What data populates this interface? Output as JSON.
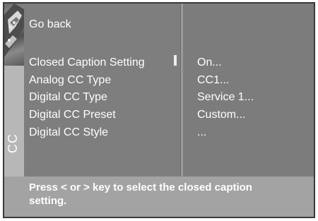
{
  "side_panel": {
    "label": "CC",
    "icon": "remote-control-photo"
  },
  "menu": {
    "go_back": "Go back",
    "items": [
      {
        "label": "Closed Caption Setting",
        "value": "On..."
      },
      {
        "label": "Analog CC Type",
        "value": "CC1..."
      },
      {
        "label": "Digital CC Type",
        "value": "Service 1..."
      },
      {
        "label": "Digital CC Preset",
        "value": "Custom..."
      },
      {
        "label": "Digital CC Style",
        "value": "..."
      }
    ],
    "selected_index": 0
  },
  "help": {
    "text": "Press < or > key to select the closed caption setting."
  },
  "colors": {
    "panel": "#7e7e7e",
    "side_strip": "#b7b7b7",
    "help_bar": "#a3a3a3",
    "text": "#ffffff"
  }
}
